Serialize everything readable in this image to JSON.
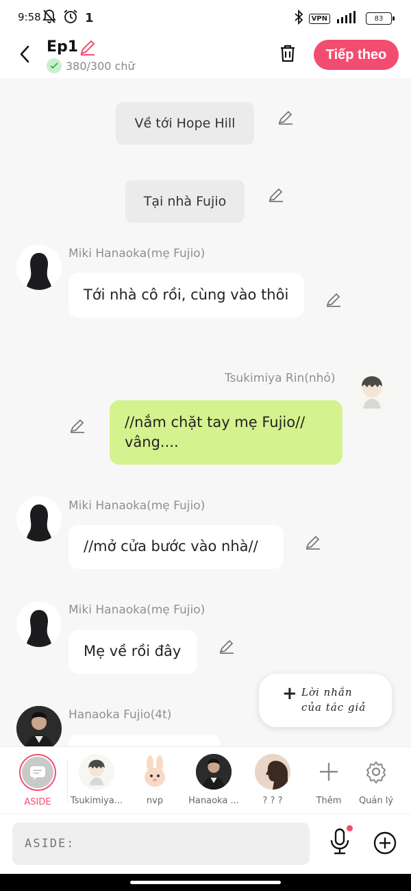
{
  "status": {
    "time": "9:58",
    "indicator": "1",
    "vpn": "VPN",
    "battery": "83"
  },
  "header": {
    "title": "Ep1",
    "word_count": "380/300 chữ",
    "next_label": "Tiếp theo"
  },
  "narrations": [
    {
      "text": "Về tới Hope Hill"
    },
    {
      "text": "Tại nhà Fujio"
    }
  ],
  "messages": [
    {
      "speaker": "Miki Hanaoka(mẹ Fujio)",
      "text": "Tới nhà cô rồi, cùng vào thôi"
    },
    {
      "speaker": "Tsukimiya Rin(nhỏ)",
      "text": "//nắm chặt tay mẹ Fujio// vâng...."
    },
    {
      "speaker": "Miki Hanaoka(mẹ Fujio)",
      "text": "//mở cửa bước vào nhà//"
    },
    {
      "speaker": "Miki Hanaoka(mẹ Fujio)",
      "text": "Mẹ về rồi đây"
    },
    {
      "speaker": "Hanaoka Fujio(4t)",
      "text": ""
    }
  ],
  "author_note": {
    "line1": "Lời nhắn",
    "line2": "của tác giả"
  },
  "characters": [
    {
      "label": "ASIDE"
    },
    {
      "label": "Tsukimiya..."
    },
    {
      "label": "nvp"
    },
    {
      "label": "Hanaoka ..."
    },
    {
      "label": "? ? ?"
    },
    {
      "label": "Thêm"
    },
    {
      "label": "Quản lý"
    }
  ],
  "input": {
    "placeholder": "ASIDE:"
  },
  "colors": {
    "accent": "#f24d70",
    "green_bubble": "#d4f28d"
  }
}
